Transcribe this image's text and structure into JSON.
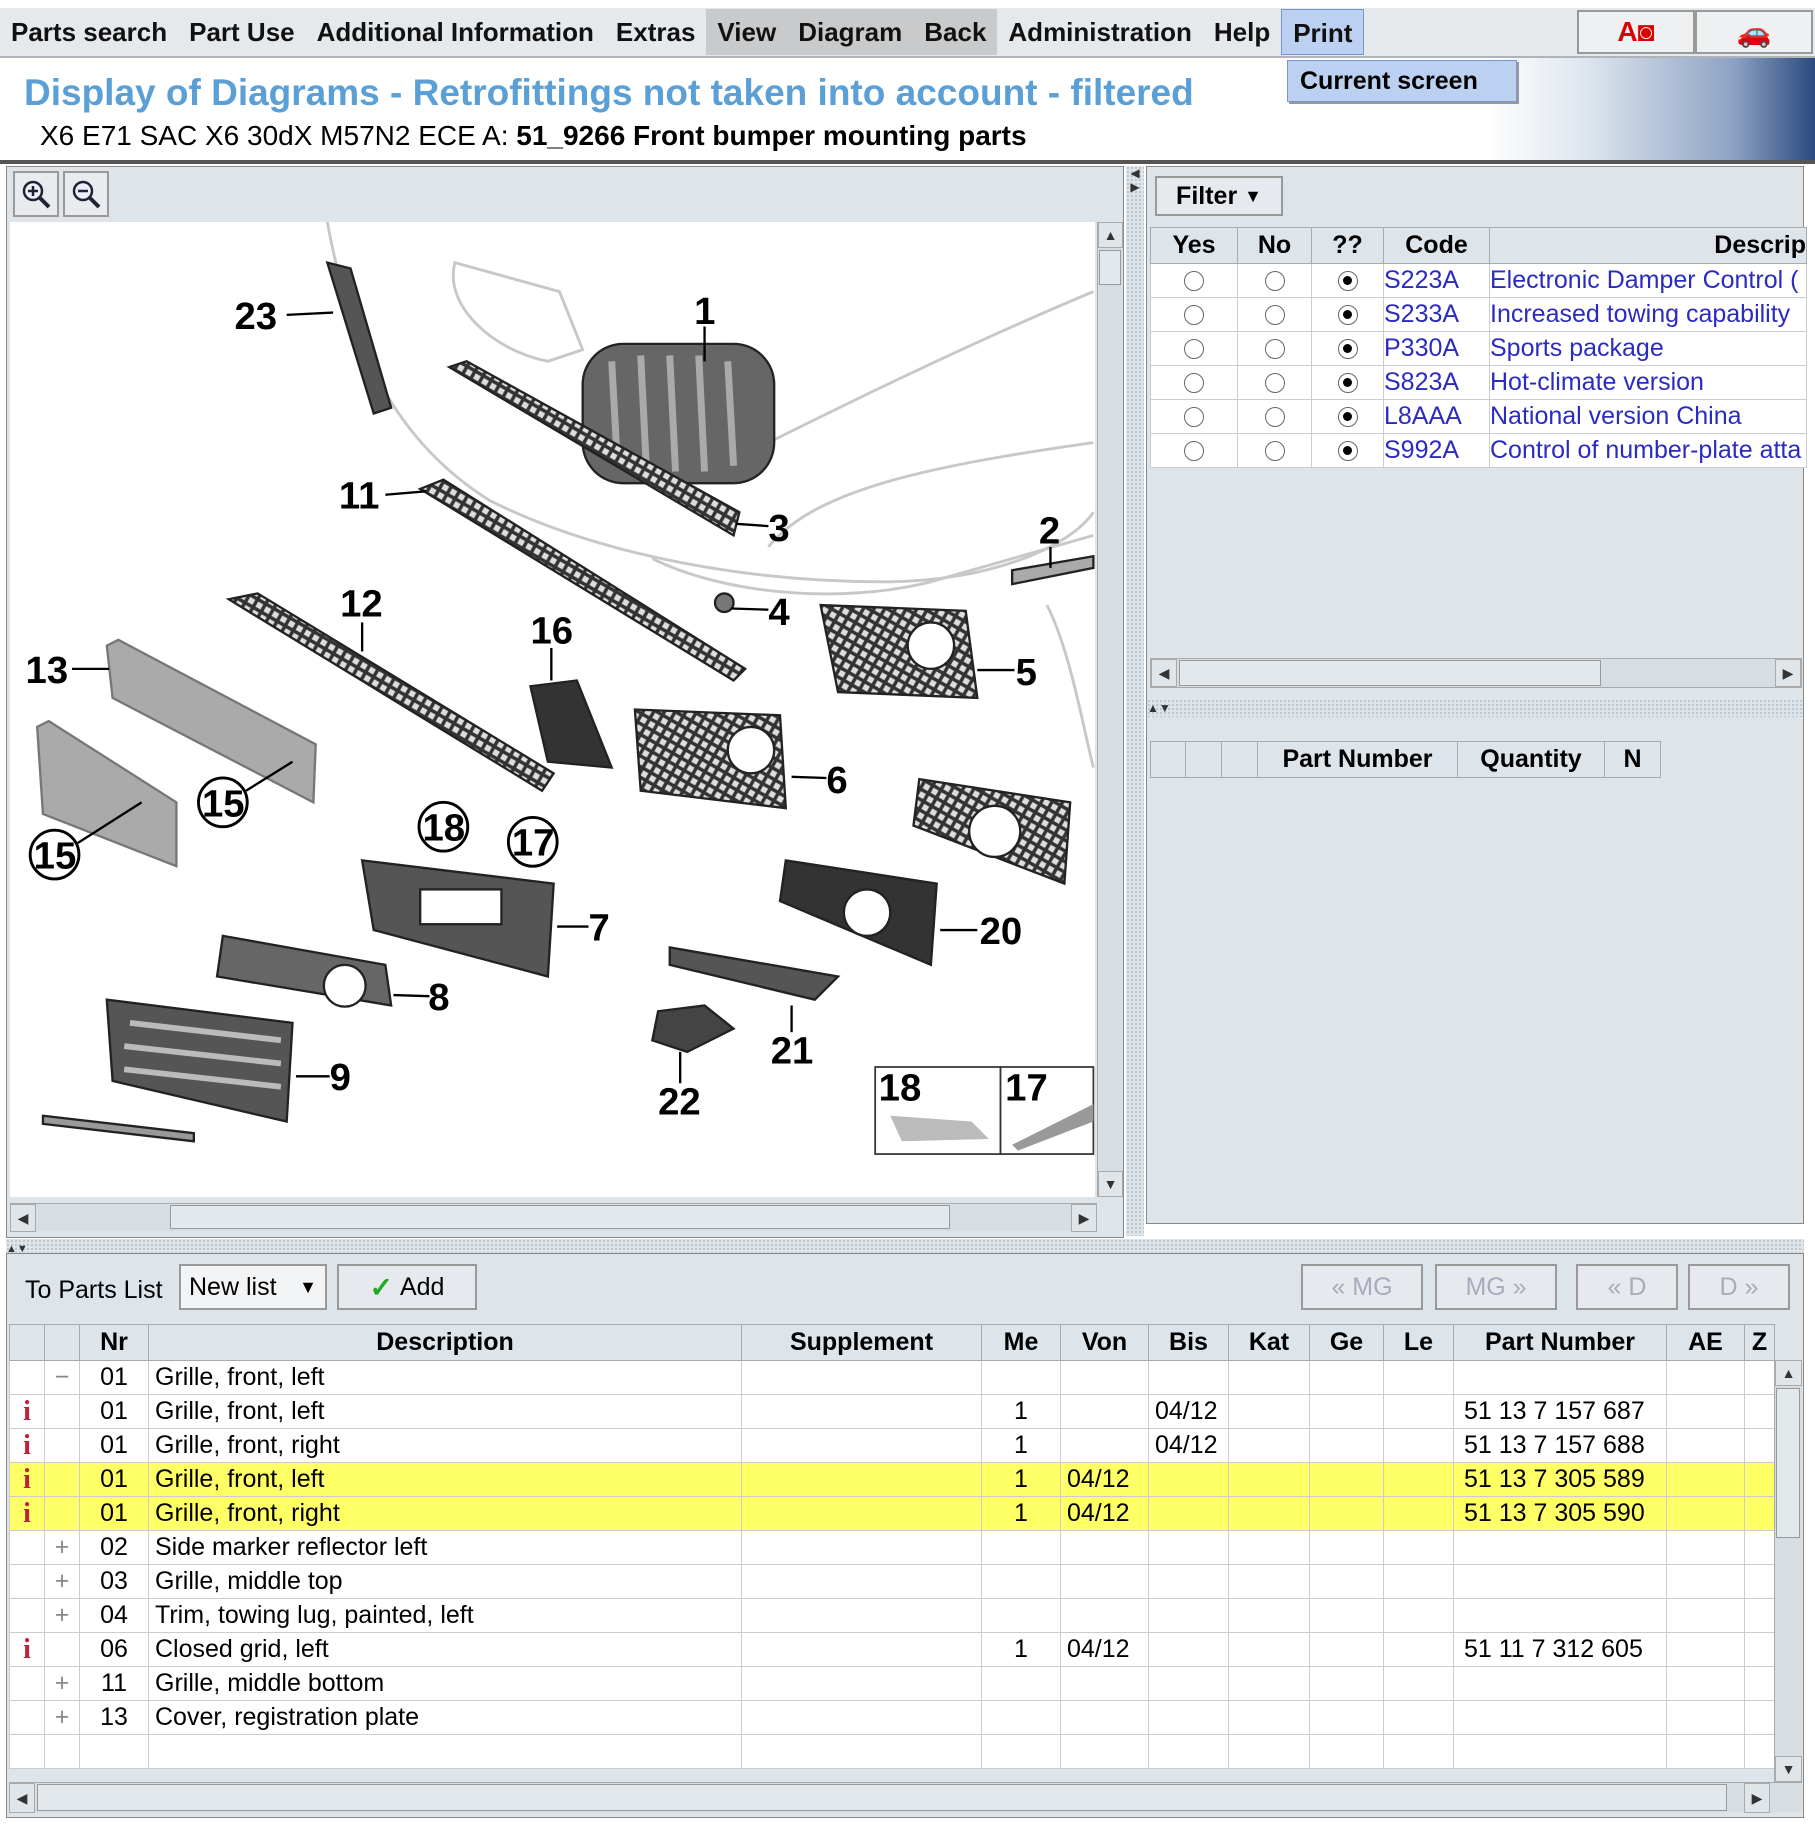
{
  "menu": {
    "items": [
      {
        "label": "Parts search",
        "style": "normal"
      },
      {
        "label": "Part Use",
        "style": "normal"
      },
      {
        "label": "Additional Information",
        "style": "normal"
      },
      {
        "label": "Extras",
        "style": "normal"
      },
      {
        "label": "View",
        "style": "dark"
      },
      {
        "label": "Diagram",
        "style": "dark"
      },
      {
        "label": "Back",
        "style": "dark"
      },
      {
        "label": "Administration",
        "style": "normal"
      },
      {
        "label": "Help",
        "style": "normal"
      },
      {
        "label": "Print",
        "style": "active"
      }
    ],
    "print_dropdown": [
      "Current screen"
    ],
    "toolbar_icons": [
      "ad-icon",
      "car-crossed-icon"
    ]
  },
  "header": {
    "title": "Display of Diagrams - Retrofittings not taken into account - filtered",
    "vehicle": "X6 E71 SAC X6 30dX M57N2 ECE  A:",
    "group": "51_9266 Front bumper mounting parts"
  },
  "diagram": {
    "tools": [
      "zoom-in-icon",
      "zoom-out-icon"
    ],
    "callouts": [
      "23",
      "1",
      "11",
      "3",
      "2",
      "4",
      "12",
      "16",
      "5",
      "13",
      "6",
      "15",
      "15",
      "18",
      "17",
      "7",
      "20",
      "8",
      "21",
      "9",
      "22"
    ],
    "inset_labels": [
      "18",
      "17"
    ]
  },
  "filter": {
    "button_label": "Filter",
    "columns": [
      "Yes",
      "No",
      "??",
      "Code",
      "Descrip"
    ],
    "rows": [
      {
        "code": "S223A",
        "description": "Electronic Damper Control (",
        "selected": "??"
      },
      {
        "code": "S233A",
        "description": "Increased towing capability",
        "selected": "??"
      },
      {
        "code": "P330A",
        "description": "Sports package",
        "selected": "??"
      },
      {
        "code": "S823A",
        "description": "Hot-climate version",
        "selected": "??"
      },
      {
        "code": "L8AAA",
        "description": "National version China",
        "selected": "??"
      },
      {
        "code": "S992A",
        "description": "Control of number-plate atta",
        "selected": "??"
      }
    ]
  },
  "partslist_panel": {
    "columns": [
      "",
      "",
      "",
      "Part Number",
      "Quantity",
      "N"
    ]
  },
  "toolbar": {
    "to_parts_list": "To Parts List",
    "list_select": "New list",
    "add_label": "Add",
    "nav": [
      "« MG",
      "MG »",
      "« D",
      "D »"
    ]
  },
  "parts_table": {
    "columns": [
      "",
      "",
      "Nr",
      "Description",
      "Supplement",
      "Me",
      "Von",
      "Bis",
      "Kat",
      "Ge",
      "Le",
      "Part Number",
      "AE",
      "Z"
    ],
    "highlight_color": "#ffff66",
    "rows": [
      {
        "icon": "",
        "exp": "−",
        "nr": "01",
        "desc": "Grille, front, left",
        "sup": "",
        "me": "",
        "von": "",
        "bis": "",
        "pn": "",
        "hl": false
      },
      {
        "icon": "i",
        "exp": "",
        "nr": "01",
        "desc": "Grille, front, left",
        "sup": "",
        "me": "1",
        "von": "",
        "bis": "04/12",
        "pn": "51 13 7 157 687",
        "hl": false
      },
      {
        "icon": "i",
        "exp": "",
        "nr": "01",
        "desc": "Grille, front, right",
        "sup": "",
        "me": "1",
        "von": "",
        "bis": "04/12",
        "pn": "51 13 7 157 688",
        "hl": false
      },
      {
        "icon": "i",
        "exp": "",
        "nr": "01",
        "desc": "Grille, front, left",
        "sup": "",
        "me": "1",
        "von": "04/12",
        "bis": "",
        "pn": "51 13 7 305 589",
        "hl": true
      },
      {
        "icon": "i",
        "exp": "",
        "nr": "01",
        "desc": "Grille, front, right",
        "sup": "",
        "me": "1",
        "von": "04/12",
        "bis": "",
        "pn": "51 13 7 305 590",
        "hl": true
      },
      {
        "icon": "",
        "exp": "+",
        "nr": "02",
        "desc": "Side marker reflector left",
        "sup": "",
        "me": "",
        "von": "",
        "bis": "",
        "pn": "",
        "hl": false
      },
      {
        "icon": "",
        "exp": "+",
        "nr": "03",
        "desc": "Grille, middle top",
        "sup": "",
        "me": "",
        "von": "",
        "bis": "",
        "pn": "",
        "hl": false
      },
      {
        "icon": "",
        "exp": "+",
        "nr": "04",
        "desc": "Trim, towing lug, painted, left",
        "sup": "",
        "me": "",
        "von": "",
        "bis": "",
        "pn": "",
        "hl": false
      },
      {
        "icon": "i",
        "exp": "",
        "nr": "06",
        "desc": "Closed grid, left",
        "sup": "",
        "me": "1",
        "von": "04/12",
        "bis": "",
        "pn": "51 11 7 312 605",
        "hl": false
      },
      {
        "icon": "",
        "exp": "+",
        "nr": "11",
        "desc": "Grille, middle bottom",
        "sup": "",
        "me": "",
        "von": "",
        "bis": "",
        "pn": "",
        "hl": false
      },
      {
        "icon": "",
        "exp": "+",
        "nr": "13",
        "desc": "Cover, registration plate",
        "sup": "",
        "me": "",
        "von": "",
        "bis": "",
        "pn": "",
        "hl": false
      },
      {
        "icon": "",
        "exp": "",
        "nr": "",
        "desc": "",
        "sup": "",
        "me": "",
        "von": "",
        "bis": "",
        "pn": "",
        "hl": false
      }
    ]
  }
}
